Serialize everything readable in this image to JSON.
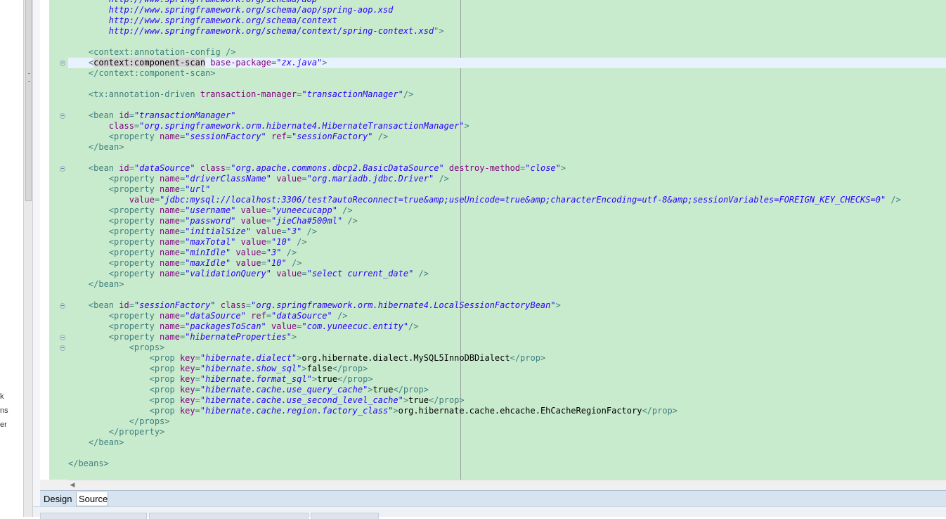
{
  "left_panel": {
    "fragments": [
      "k",
      "ns",
      "er"
    ]
  },
  "editor": {
    "lines": [
      [
        {
          "c": "val",
          "t": "        http://www.springframework.org/schema/aop"
        }
      ],
      [
        {
          "c": "val",
          "t": "        http://www.springframework.org/schema/aop/spring-aop.xsd"
        }
      ],
      [
        {
          "c": "val",
          "t": "        http://www.springframework.org/schema/context"
        }
      ],
      [
        {
          "c": "val",
          "t": "        http://www.springframework.org/schema/context/spring-context.xsd"
        },
        {
          "c": "tag",
          "t": "\">"
        }
      ],
      [],
      [
        {
          "c": "tag",
          "t": "    <context:annotation-config />"
        }
      ],
      [
        {
          "c": "tag",
          "t": "    <"
        },
        {
          "c": "sel",
          "t": "context:component-scan"
        },
        {
          "c": "tag",
          "t": " "
        },
        {
          "c": "attr",
          "t": "base-package"
        },
        {
          "c": "tag",
          "t": "="
        },
        {
          "c": "val",
          "t": "\"zx.java\""
        },
        {
          "c": "tag",
          "t": ">"
        }
      ],
      [
        {
          "c": "tag",
          "t": "    </context:component-scan>"
        }
      ],
      [],
      [
        {
          "c": "tag",
          "t": "    <tx:annotation-driven "
        },
        {
          "c": "attr",
          "t": "transaction-manager"
        },
        {
          "c": "tag",
          "t": "="
        },
        {
          "c": "val",
          "t": "\"transactionManager\""
        },
        {
          "c": "tag",
          "t": "/>"
        }
      ],
      [],
      [
        {
          "c": "tag",
          "t": "    <bean "
        },
        {
          "c": "attr",
          "t": "id"
        },
        {
          "c": "tag",
          "t": "="
        },
        {
          "c": "val",
          "t": "\"transactionManager\""
        }
      ],
      [
        {
          "c": "attr",
          "t": "        class"
        },
        {
          "c": "tag",
          "t": "="
        },
        {
          "c": "val",
          "t": "\"org.springframework.orm.hibernate4.HibernateTransactionManager\""
        },
        {
          "c": "tag",
          "t": ">"
        }
      ],
      [
        {
          "c": "tag",
          "t": "        <property "
        },
        {
          "c": "attr",
          "t": "name"
        },
        {
          "c": "tag",
          "t": "="
        },
        {
          "c": "val",
          "t": "\"sessionFactory\""
        },
        {
          "c": "tag",
          "t": " "
        },
        {
          "c": "attr",
          "t": "ref"
        },
        {
          "c": "tag",
          "t": "="
        },
        {
          "c": "val",
          "t": "\"sessionFactory\""
        },
        {
          "c": "tag",
          "t": " />"
        }
      ],
      [
        {
          "c": "tag",
          "t": "    </bean>"
        }
      ],
      [],
      [
        {
          "c": "tag",
          "t": "    <bean "
        },
        {
          "c": "attr",
          "t": "id"
        },
        {
          "c": "tag",
          "t": "="
        },
        {
          "c": "val",
          "t": "\"dataSource\""
        },
        {
          "c": "tag",
          "t": " "
        },
        {
          "c": "attr",
          "t": "class"
        },
        {
          "c": "tag",
          "t": "="
        },
        {
          "c": "val",
          "t": "\"org.apache.commons.dbcp2.BasicDataSource\""
        },
        {
          "c": "tag",
          "t": " "
        },
        {
          "c": "attr",
          "t": "destroy-method"
        },
        {
          "c": "tag",
          "t": "="
        },
        {
          "c": "val",
          "t": "\"close\""
        },
        {
          "c": "tag",
          "t": ">"
        }
      ],
      [
        {
          "c": "tag",
          "t": "        <property "
        },
        {
          "c": "attr",
          "t": "name"
        },
        {
          "c": "tag",
          "t": "="
        },
        {
          "c": "val",
          "t": "\"driverClassName\""
        },
        {
          "c": "tag",
          "t": " "
        },
        {
          "c": "attr",
          "t": "value"
        },
        {
          "c": "tag",
          "t": "="
        },
        {
          "c": "val",
          "t": "\"org.mariadb.jdbc.Driver\""
        },
        {
          "c": "tag",
          "t": " />"
        }
      ],
      [
        {
          "c": "tag",
          "t": "        <property "
        },
        {
          "c": "attr",
          "t": "name"
        },
        {
          "c": "tag",
          "t": "="
        },
        {
          "c": "val",
          "t": "\"url\""
        }
      ],
      [
        {
          "c": "attr",
          "t": "            value"
        },
        {
          "c": "tag",
          "t": "="
        },
        {
          "c": "val",
          "t": "\"jdbc:mysql://localhost:3306/test?autoReconnect=true&amp;useUnicode=true&amp;characterEncoding=utf-8&amp;sessionVariables=FOREIGN_KEY_CHECKS=0\""
        },
        {
          "c": "tag",
          "t": " />"
        }
      ],
      [
        {
          "c": "tag",
          "t": "        <property "
        },
        {
          "c": "attr",
          "t": "name"
        },
        {
          "c": "tag",
          "t": "="
        },
        {
          "c": "val",
          "t": "\"username\""
        },
        {
          "c": "tag",
          "t": " "
        },
        {
          "c": "attr",
          "t": "value"
        },
        {
          "c": "tag",
          "t": "="
        },
        {
          "c": "val",
          "t": "\"yuneecucapp\""
        },
        {
          "c": "tag",
          "t": " />"
        }
      ],
      [
        {
          "c": "tag",
          "t": "        <property "
        },
        {
          "c": "attr",
          "t": "name"
        },
        {
          "c": "tag",
          "t": "="
        },
        {
          "c": "val",
          "t": "\"password\""
        },
        {
          "c": "tag",
          "t": " "
        },
        {
          "c": "attr",
          "t": "value"
        },
        {
          "c": "tag",
          "t": "="
        },
        {
          "c": "val",
          "t": "\"jieCha#500ml\""
        },
        {
          "c": "tag",
          "t": " />"
        }
      ],
      [
        {
          "c": "tag",
          "t": "        <property "
        },
        {
          "c": "attr",
          "t": "name"
        },
        {
          "c": "tag",
          "t": "="
        },
        {
          "c": "val",
          "t": "\"initialSize\""
        },
        {
          "c": "tag",
          "t": " "
        },
        {
          "c": "attr",
          "t": "value"
        },
        {
          "c": "tag",
          "t": "="
        },
        {
          "c": "val",
          "t": "\"3\""
        },
        {
          "c": "tag",
          "t": " />"
        }
      ],
      [
        {
          "c": "tag",
          "t": "        <property "
        },
        {
          "c": "attr",
          "t": "name"
        },
        {
          "c": "tag",
          "t": "="
        },
        {
          "c": "val",
          "t": "\"maxTotal\""
        },
        {
          "c": "tag",
          "t": " "
        },
        {
          "c": "attr",
          "t": "value"
        },
        {
          "c": "tag",
          "t": "="
        },
        {
          "c": "val",
          "t": "\"10\""
        },
        {
          "c": "tag",
          "t": " />"
        }
      ],
      [
        {
          "c": "tag",
          "t": "        <property "
        },
        {
          "c": "attr",
          "t": "name"
        },
        {
          "c": "tag",
          "t": "="
        },
        {
          "c": "val",
          "t": "\"minIdle\""
        },
        {
          "c": "tag",
          "t": " "
        },
        {
          "c": "attr",
          "t": "value"
        },
        {
          "c": "tag",
          "t": "="
        },
        {
          "c": "val",
          "t": "\"3\""
        },
        {
          "c": "tag",
          "t": " />"
        }
      ],
      [
        {
          "c": "tag",
          "t": "        <property "
        },
        {
          "c": "attr",
          "t": "name"
        },
        {
          "c": "tag",
          "t": "="
        },
        {
          "c": "val",
          "t": "\"maxIdle\""
        },
        {
          "c": "tag",
          "t": " "
        },
        {
          "c": "attr",
          "t": "value"
        },
        {
          "c": "tag",
          "t": "="
        },
        {
          "c": "val",
          "t": "\"10\""
        },
        {
          "c": "tag",
          "t": " />"
        }
      ],
      [
        {
          "c": "tag",
          "t": "        <property "
        },
        {
          "c": "attr",
          "t": "name"
        },
        {
          "c": "tag",
          "t": "="
        },
        {
          "c": "val",
          "t": "\"validationQuery\""
        },
        {
          "c": "tag",
          "t": " "
        },
        {
          "c": "attr",
          "t": "value"
        },
        {
          "c": "tag",
          "t": "="
        },
        {
          "c": "val",
          "t": "\"select current_date\""
        },
        {
          "c": "tag",
          "t": " />"
        }
      ],
      [
        {
          "c": "tag",
          "t": "    </bean>"
        }
      ],
      [],
      [
        {
          "c": "tag",
          "t": "    <bean "
        },
        {
          "c": "attr",
          "t": "id"
        },
        {
          "c": "tag",
          "t": "="
        },
        {
          "c": "val",
          "t": "\"sessionFactory\""
        },
        {
          "c": "tag",
          "t": " "
        },
        {
          "c": "attr",
          "t": "class"
        },
        {
          "c": "tag",
          "t": "="
        },
        {
          "c": "val",
          "t": "\"org.springframework.orm.hibernate4.LocalSessionFactoryBean\""
        },
        {
          "c": "tag",
          "t": ">"
        }
      ],
      [
        {
          "c": "tag",
          "t": "        <property "
        },
        {
          "c": "attr",
          "t": "name"
        },
        {
          "c": "tag",
          "t": "="
        },
        {
          "c": "val",
          "t": "\"dataSource\""
        },
        {
          "c": "tag",
          "t": " "
        },
        {
          "c": "attr",
          "t": "ref"
        },
        {
          "c": "tag",
          "t": "="
        },
        {
          "c": "val",
          "t": "\"dataSource\""
        },
        {
          "c": "tag",
          "t": " />"
        }
      ],
      [
        {
          "c": "tag",
          "t": "        <property "
        },
        {
          "c": "attr",
          "t": "name"
        },
        {
          "c": "tag",
          "t": "="
        },
        {
          "c": "val",
          "t": "\"packagesToScan\""
        },
        {
          "c": "tag",
          "t": " "
        },
        {
          "c": "attr",
          "t": "value"
        },
        {
          "c": "tag",
          "t": "="
        },
        {
          "c": "val",
          "t": "\"com.yuneecuc.entity\""
        },
        {
          "c": "tag",
          "t": "/>"
        }
      ],
      [
        {
          "c": "tag",
          "t": "        <property "
        },
        {
          "c": "attr",
          "t": "name"
        },
        {
          "c": "tag",
          "t": "="
        },
        {
          "c": "val",
          "t": "\"hibernateProperties\""
        },
        {
          "c": "tag",
          "t": ">"
        }
      ],
      [
        {
          "c": "tag",
          "t": "            <props>"
        }
      ],
      [
        {
          "c": "tag",
          "t": "                <prop "
        },
        {
          "c": "attr",
          "t": "key"
        },
        {
          "c": "tag",
          "t": "="
        },
        {
          "c": "val",
          "t": "\"hibernate.dialect\""
        },
        {
          "c": "tag",
          "t": ">"
        },
        {
          "c": "txt",
          "t": "org.hibernate.dialect.MySQL5InnoDBDialect"
        },
        {
          "c": "tag",
          "t": "</prop>"
        }
      ],
      [
        {
          "c": "tag",
          "t": "                <prop "
        },
        {
          "c": "attr",
          "t": "key"
        },
        {
          "c": "tag",
          "t": "="
        },
        {
          "c": "val",
          "t": "\"hibernate.show_sql\""
        },
        {
          "c": "tag",
          "t": ">"
        },
        {
          "c": "txt",
          "t": "false"
        },
        {
          "c": "tag",
          "t": "</prop>"
        }
      ],
      [
        {
          "c": "tag",
          "t": "                <prop "
        },
        {
          "c": "attr",
          "t": "key"
        },
        {
          "c": "tag",
          "t": "="
        },
        {
          "c": "val",
          "t": "\"hibernate.format_sql\""
        },
        {
          "c": "tag",
          "t": ">"
        },
        {
          "c": "txt",
          "t": "true"
        },
        {
          "c": "tag",
          "t": "</prop>"
        }
      ],
      [
        {
          "c": "tag",
          "t": "                <prop "
        },
        {
          "c": "attr",
          "t": "key"
        },
        {
          "c": "tag",
          "t": "="
        },
        {
          "c": "val",
          "t": "\"hibernate.cache.use_query_cache\""
        },
        {
          "c": "tag",
          "t": ">"
        },
        {
          "c": "txt",
          "t": "true"
        },
        {
          "c": "tag",
          "t": "</prop>"
        }
      ],
      [
        {
          "c": "tag",
          "t": "                <prop "
        },
        {
          "c": "attr",
          "t": "key"
        },
        {
          "c": "tag",
          "t": "="
        },
        {
          "c": "val",
          "t": "\"hibernate.cache.use_second_level_cache\""
        },
        {
          "c": "tag",
          "t": ">"
        },
        {
          "c": "txt",
          "t": "true"
        },
        {
          "c": "tag",
          "t": "</prop>"
        }
      ],
      [
        {
          "c": "tag",
          "t": "                <prop "
        },
        {
          "c": "attr",
          "t": "key"
        },
        {
          "c": "tag",
          "t": "="
        },
        {
          "c": "val",
          "t": "\"hibernate.cache.region.factory_class\""
        },
        {
          "c": "tag",
          "t": ">"
        },
        {
          "c": "txt",
          "t": "org.hibernate.cache.ehcache.EhCacheRegionFactory"
        },
        {
          "c": "tag",
          "t": "</prop>"
        }
      ],
      [
        {
          "c": "tag",
          "t": "            </props>"
        }
      ],
      [
        {
          "c": "tag",
          "t": "        </property>"
        }
      ],
      [
        {
          "c": "tag",
          "t": "    </bean>"
        }
      ],
      [],
      [
        {
          "c": "tag",
          "t": "</beans>"
        }
      ]
    ],
    "folded_lines": [
      6,
      11,
      16,
      29,
      32,
      33
    ],
    "current_line": 6
  },
  "tabs": {
    "design": "Design",
    "source": "Source"
  },
  "colors": {
    "editor_background": "#c9ebcd",
    "tag": "#3f7f7f",
    "attribute": "#7f007f",
    "value": "#2a00ff"
  },
  "icons": {
    "fold_marker": "collapse-icon",
    "scroll_left": "scroll-left-icon"
  }
}
